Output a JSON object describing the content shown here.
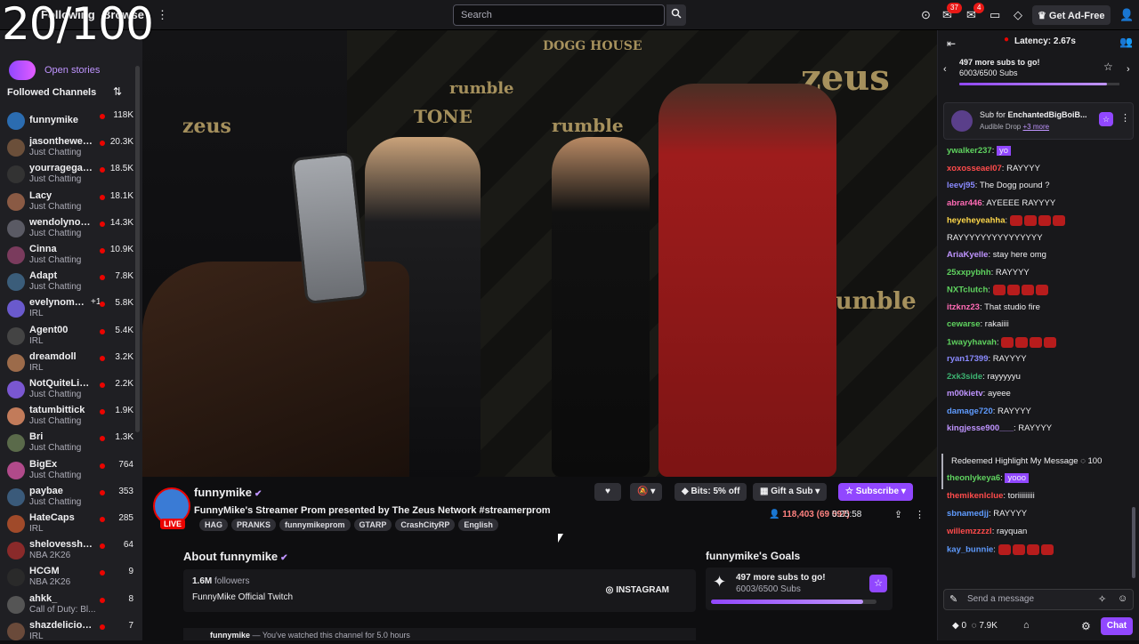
{
  "overlay_counter": "20/100",
  "topbar": {
    "following": "Following",
    "browse": "Browse",
    "search_placeholder": "Search",
    "notif_count_1": "37",
    "notif_count_2": "4",
    "get_ad_free": "Get Ad-Free"
  },
  "sidebar": {
    "open_stories": "Open stories",
    "followed_title": "Followed Channels",
    "channels": [
      {
        "name": "funnymike",
        "game": "",
        "viewers": "118K"
      },
      {
        "name": "jasontheween",
        "game": "Just Chatting",
        "viewers": "20.3K"
      },
      {
        "name": "yourragegami...",
        "game": "Just Chatting",
        "viewers": "18.5K"
      },
      {
        "name": "Lacy",
        "game": "Just Chatting",
        "viewers": "18.1K"
      },
      {
        "name": "wendolynortizz",
        "game": "Just Chatting",
        "viewers": "14.3K"
      },
      {
        "name": "Cinna",
        "game": "Just Chatting",
        "viewers": "10.9K"
      },
      {
        "name": "Adapt",
        "game": "Just Chatting",
        "viewers": "7.8K"
      },
      {
        "name": "evelynomad...",
        "game": "IRL",
        "viewers": "5.8K",
        "plus": "+1"
      },
      {
        "name": "Agent00",
        "game": "IRL",
        "viewers": "5.4K"
      },
      {
        "name": "dreamdoll",
        "game": "IRL",
        "viewers": "3.2K"
      },
      {
        "name": "NotQuiteLikeDuB",
        "game": "Just Chatting",
        "viewers": "2.2K"
      },
      {
        "name": "tatumbittick",
        "game": "Just Chatting",
        "viewers": "1.9K"
      },
      {
        "name": "Bri",
        "game": "Just Chatting",
        "viewers": "1.3K"
      },
      {
        "name": "BigEx",
        "game": "Just Chatting",
        "viewers": "764"
      },
      {
        "name": "paybae",
        "game": "Just Chatting",
        "viewers": "353"
      },
      {
        "name": "HateCaps",
        "game": "IRL",
        "viewers": "285"
      },
      {
        "name": "shelovesshifty",
        "game": "NBA 2K26",
        "viewers": "64"
      },
      {
        "name": "HCGM",
        "game": "NBA 2K26",
        "viewers": "9"
      },
      {
        "name": "ahkk_",
        "game": "Call of Duty: Bl...",
        "viewers": "8"
      },
      {
        "name": "shazdelicious",
        "game": "IRL",
        "viewers": "7"
      }
    ]
  },
  "video": {
    "signage": [
      "zeus",
      "rumble",
      "DOGG HOUSE",
      "TONE",
      "rumble",
      "zeus",
      "rumble"
    ]
  },
  "stream": {
    "name": "funnymike",
    "title": "FunnyMike's Streamer Prom presented by The Zeus Network #streamerprom",
    "live": "LIVE",
    "tags": [
      "HAG",
      "PRANKS",
      "funnymikeprom",
      "GTARP",
      "CrashCityRP",
      "English"
    ],
    "bits": "Bits: 5% off",
    "gift": "Gift a Sub",
    "subscribe": "Subscribe",
    "viewers": "118,403 (69 597)",
    "uptime": "0:25:58"
  },
  "about": {
    "title": "About funnymike",
    "followers_num": "1.6M",
    "followers_label": "followers",
    "description": "FunnyMike Official Twitch",
    "instagram": "INSTAGRAM"
  },
  "goals": {
    "title": "funnymike's Goals",
    "line1": "497 more subs to go!",
    "line2": "6003/6500 Subs",
    "progress": 0.92
  },
  "bottom_row": {
    "name": "funnymike",
    "text": "You've watched this channel for 5.0 hours"
  },
  "chat": {
    "latency": "Latency: 2.67s",
    "goal_line1": "497 more subs to go!",
    "goal_line2": "6003/6500 Subs",
    "pinned_title_prefix": "Sub for",
    "pinned_title_name": "EnchantedBigBoiB...",
    "pinned_sub": "Audible Drop",
    "pinned_more": "+3 more",
    "messages": [
      {
        "user": "ywalker237",
        "color": "#5fd35f",
        "text": "yo",
        "highlight": true
      },
      {
        "user": "xoxosseael07",
        "color": "#ff4b4b",
        "text": "RAYYYY"
      },
      {
        "user": "leevj95",
        "color": "#8a8aff",
        "text": "The Dogg pound ?"
      },
      {
        "user": "abrar446",
        "color": "#ff6bb5",
        "text": "AYEEEE RAYYYY"
      },
      {
        "user": "heyeheyeahha",
        "color": "#ffd84a",
        "text": ""
      },
      {
        "user": "",
        "color": "#efeff1",
        "text": "RAYYYYYYYYYYYYYYY"
      },
      {
        "user": "AriaKyelle",
        "color": "#bf94ff",
        "text": "stay here omg"
      },
      {
        "user": "25xxpybhh",
        "color": "#5fd35f",
        "text": "RAYYYY"
      },
      {
        "user": "NXTclutch",
        "color": "#5fd35f",
        "text": ""
      },
      {
        "user": "itzknz23",
        "color": "#ff6bb5",
        "text": "That studio fire"
      },
      {
        "user": "cewarse",
        "color": "#5fd35f",
        "text": "rakaiiii"
      },
      {
        "user": "1wayyhavah",
        "color": "#5fd35f",
        "text": ""
      },
      {
        "user": "ryan17399",
        "color": "#8a8aff",
        "text": "RAYYYY"
      },
      {
        "user": "2xk3side",
        "color": "#3cb371",
        "text": "rayyyyyu"
      },
      {
        "user": "m00kietv",
        "color": "#bf94ff",
        "text": "ayeee"
      },
      {
        "user": "damage720",
        "color": "#5f9bff",
        "text": "RAYYYY"
      },
      {
        "user": "kingjesse900___",
        "color": "#bf94ff",
        "text": "RAYYYY"
      }
    ],
    "redeem_text": "Redeemed Highlight My Message",
    "redeem_cost": "100",
    "after_messages": [
      {
        "user": "theonlykeya6",
        "color": "#5fd35f",
        "text": "yooo",
        "highlight": true
      },
      {
        "user": "themikenlclue",
        "color": "#ff4b4b",
        "text": "toriiiiiiiii"
      },
      {
        "user": "sbnamedjj",
        "color": "#5f9bff",
        "text": "RAYYYY"
      },
      {
        "user": "willemzzzzl",
        "color": "#ff4b4b",
        "text": "rayquan"
      },
      {
        "user": "kay_bunnie",
        "color": "#5f9bff",
        "text": ""
      }
    ],
    "input_placeholder": "Send a message",
    "points": "0",
    "points2": "7.9K",
    "chat_button": "Chat"
  },
  "colors": {
    "accent": "#9147ff",
    "live": "#eb0400",
    "bg": "#0e0e10",
    "panel": "#18181b"
  }
}
